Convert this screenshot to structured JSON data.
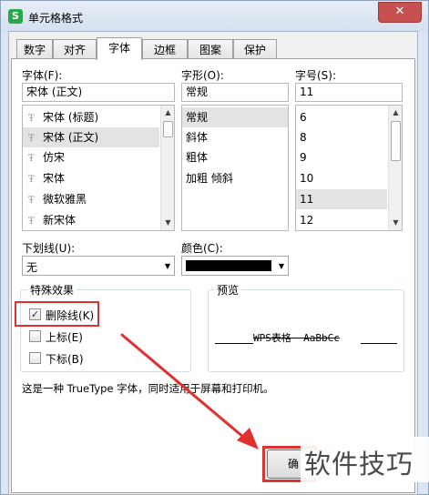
{
  "dialog": {
    "title": "单元格格式",
    "app_icon_letter": "S",
    "close_glyph": "✕"
  },
  "tabs": [
    {
      "label": "数字"
    },
    {
      "label": "对齐"
    },
    {
      "label": "字体"
    },
    {
      "label": "边框"
    },
    {
      "label": "图案"
    },
    {
      "label": "保护"
    }
  ],
  "active_tab": "字体",
  "font": {
    "label": "字体(F):",
    "value": "宋体 (正文)",
    "items": [
      "宋体 (标题)",
      "宋体 (正文)",
      "仿宋",
      "宋体",
      "微软雅黑",
      "新宋体"
    ],
    "selected": "宋体 (正文)",
    "item_icon_glyph": "Ŧ"
  },
  "style": {
    "label": "字形(O):",
    "value": "常规",
    "items": [
      "常规",
      "斜体",
      "粗体",
      "加粗 倾斜"
    ],
    "selected": "常规"
  },
  "size": {
    "label": "字号(S):",
    "value": "11",
    "items": [
      "6",
      "8",
      "9",
      "10",
      "11",
      "12"
    ],
    "selected": "11"
  },
  "underline": {
    "label": "下划线(U):",
    "value": "无"
  },
  "color": {
    "label": "颜色(C):",
    "value_color": "#000000"
  },
  "effects": {
    "title": "特殊效果",
    "strikethrough": {
      "label": "删除线(K)",
      "checked": true
    },
    "superscript": {
      "label": "上标(E)",
      "checked": false
    },
    "subscript": {
      "label": "下标(B)",
      "checked": false
    }
  },
  "preview": {
    "title": "预览",
    "sample": "WPS表格  AaBbCc"
  },
  "info_text": "这是一种 TrueType 字体，同时适用于屏幕和打印机。",
  "ok_button": {
    "label": "确"
  },
  "watermark": {
    "text": "软件技巧"
  },
  "annotation_color": "#e03030"
}
